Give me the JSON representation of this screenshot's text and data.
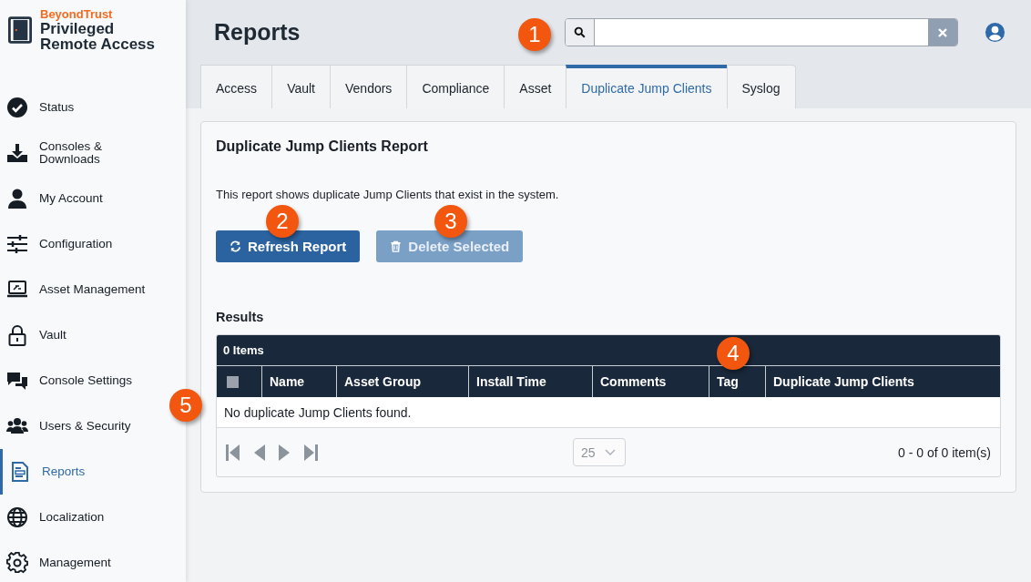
{
  "brand": {
    "company": "BeyondTrust",
    "product_line1": "Privileged",
    "product_line2": "Remote Access"
  },
  "sidebar": {
    "items": [
      {
        "label": "Status",
        "selected": false
      },
      {
        "label": "Consoles & Downloads",
        "selected": false
      },
      {
        "label": "My Account",
        "selected": false
      },
      {
        "label": "Configuration",
        "selected": false
      },
      {
        "label": "Asset Management",
        "selected": false
      },
      {
        "label": "Vault",
        "selected": false
      },
      {
        "label": "Console Settings",
        "selected": false
      },
      {
        "label": "Users & Security",
        "selected": false
      },
      {
        "label": "Reports",
        "selected": true
      },
      {
        "label": "Localization",
        "selected": false
      },
      {
        "label": "Management",
        "selected": false
      }
    ]
  },
  "header": {
    "title": "Reports"
  },
  "tabs": [
    {
      "label": "Access",
      "selected": false
    },
    {
      "label": "Vault",
      "selected": false
    },
    {
      "label": "Vendors",
      "selected": false
    },
    {
      "label": "Compliance",
      "selected": false
    },
    {
      "label": "Asset",
      "selected": false
    },
    {
      "label": "Duplicate Jump Clients",
      "selected": true
    },
    {
      "label": "Syslog",
      "selected": false
    }
  ],
  "report": {
    "title": "Duplicate Jump Clients Report",
    "description": "This report shows duplicate Jump Clients that exist in the system.",
    "buttons": [
      {
        "label": "Refresh Report",
        "disabled": false
      },
      {
        "label": "Delete Selected",
        "disabled": true
      }
    ],
    "results_label": "Results",
    "table": {
      "count": "0 Items",
      "select_all_checked": false,
      "columns": [
        "Name",
        "Asset Group",
        "Install Time",
        "Comments",
        "Tag",
        "Duplicate Jump Clients"
      ],
      "empty_message": "No duplicate Jump Clients found.",
      "page_size": "25",
      "range": "0 - 0 of 0 item(s)"
    }
  },
  "callouts": [
    "1",
    "2",
    "3",
    "4",
    "5"
  ]
}
